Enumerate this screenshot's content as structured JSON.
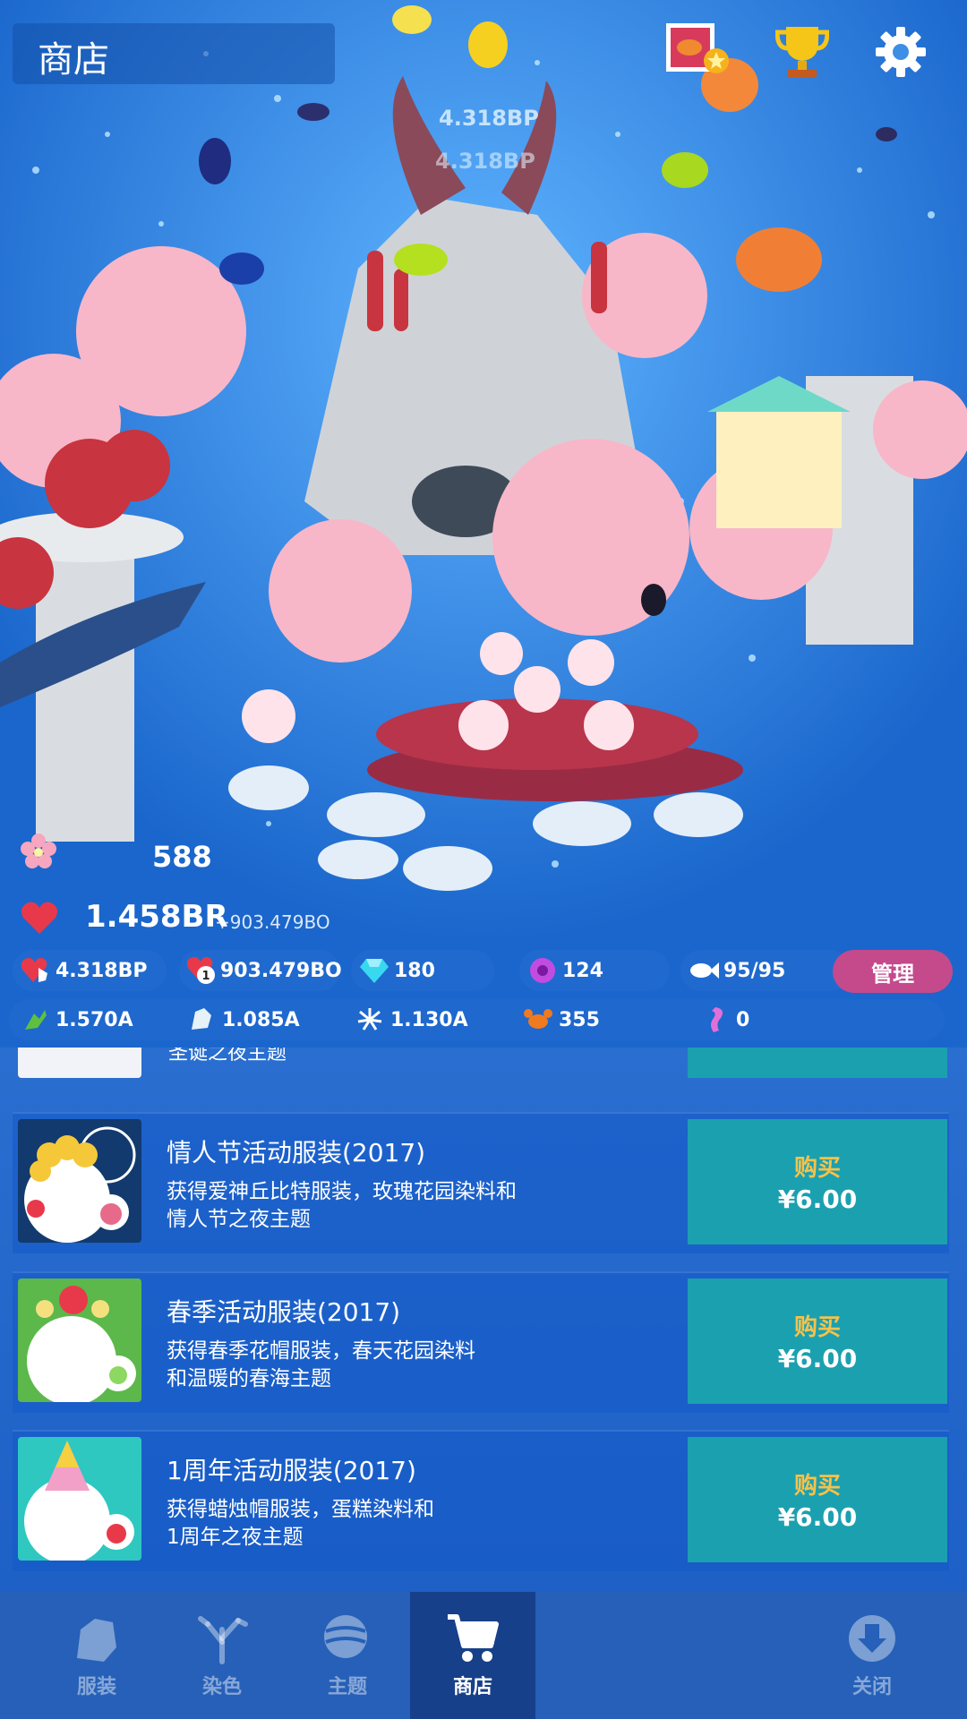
{
  "header": {
    "title": "商店",
    "floating_bp_1": "4.318BP",
    "floating_bp_2": "4.318BP",
    "icons": [
      "photo-badge-icon",
      "trophy-icon",
      "gear-icon"
    ]
  },
  "stats": {
    "flower_count": "588",
    "hearts": "1.458BR",
    "hearts_rate": "+903.479BO",
    "tap_rate": "4.318BP",
    "timer_rate": "903.479BO",
    "gems": "180",
    "orbs": "124",
    "fish": "95/95",
    "manage_label": "管理",
    "coral_green": "1.570A",
    "coral_white": "1.085A",
    "anemone": "1.130A",
    "crab": "355",
    "seahorse": "0"
  },
  "shop": {
    "partial_item_text": "圣诞之夜主题",
    "items": [
      {
        "title": "情人节活动服装(2017)",
        "desc": "获得爱神丘比特服装，玫瑰花园染料和情人节之夜主题",
        "desc_line1": "获得爱神丘比特服装，玫瑰花园染料和",
        "desc_line2": "情人节之夜主题",
        "buy_label": "购买",
        "price": "¥6.00"
      },
      {
        "title": "春季活动服装(2017)",
        "desc": "获得春季花帽服装，春天花园染料和温暖的春海主题",
        "desc_line1": "获得春季花帽服装，春天花园染料",
        "desc_line2": "和温暖的春海主题",
        "buy_label": "购买",
        "price": "¥6.00"
      },
      {
        "title": "1周年活动服装(2017)",
        "desc": "获得蜡烛帽服装，蛋糕染料和1周年之夜主题",
        "desc_line1": "获得蜡烛帽服装，蛋糕染料和",
        "desc_line2": "1周年之夜主题",
        "buy_label": "购买",
        "price": "¥6.00"
      }
    ]
  },
  "nav": {
    "tabs": [
      {
        "label": "服装",
        "icon": "outfit-icon",
        "active": false
      },
      {
        "label": "染色",
        "icon": "dye-icon",
        "active": false
      },
      {
        "label": "主题",
        "icon": "theme-icon",
        "active": false
      },
      {
        "label": "商店",
        "icon": "cart-icon",
        "active": true
      },
      {
        "label": "关闭",
        "icon": "close-down-icon",
        "active": false
      }
    ]
  },
  "colors": {
    "buy_button": "#1ba0b0",
    "buy_label": "#f6c24a",
    "manage_button": "#c44a8c",
    "nav_bg": "#2660b8",
    "nav_active": "#17408a"
  }
}
